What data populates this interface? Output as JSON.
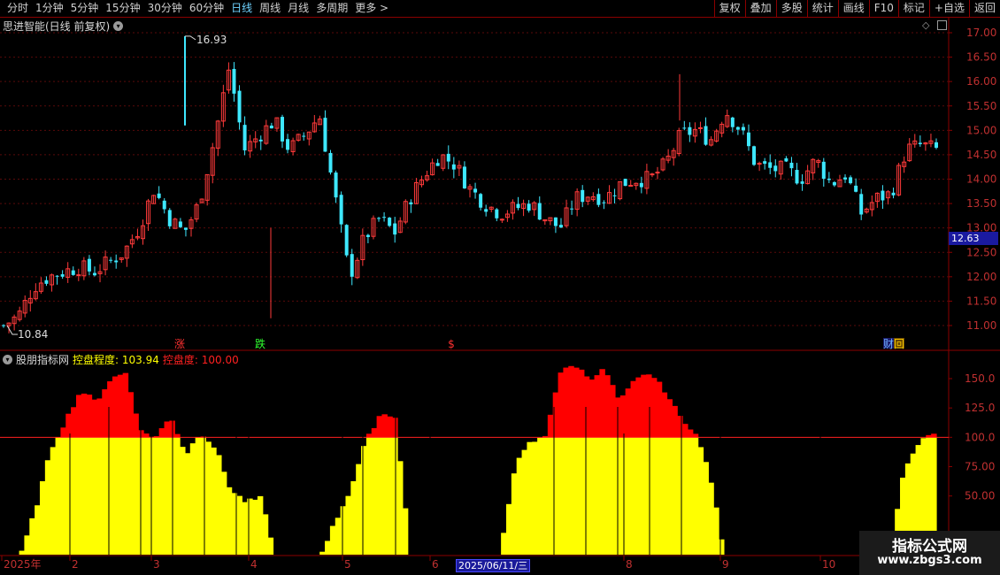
{
  "toolbar": {
    "left": [
      "分时",
      "1分钟",
      "5分钟",
      "15分钟",
      "30分钟",
      "60分钟",
      "日线",
      "周线",
      "月线",
      "多周期",
      "更多 >"
    ],
    "active": "日线",
    "right": [
      "复权",
      "叠加",
      "多股",
      "统计",
      "画线",
      "F10",
      "标记",
      "+自选",
      "返回"
    ]
  },
  "main_chart": {
    "title": "思进智能(日线 前复权)",
    "y_ticks": [
      "17.00",
      "16.50",
      "16.00",
      "15.50",
      "15.00",
      "14.50",
      "14.00",
      "13.50",
      "13.00",
      "12.50",
      "12.00",
      "11.50",
      "11.00"
    ],
    "current_price": "12.63",
    "high_label": "16.93",
    "low_label": "10.84",
    "markers": [
      {
        "text": "涨",
        "color": "#ff3030"
      },
      {
        "text": "跌",
        "color": "#30ff30"
      },
      {
        "text": "$",
        "color": "#ff3030"
      },
      {
        "text": "财",
        "color": "#6fb0ff"
      },
      {
        "text": "回",
        "color": "#ffcc00"
      }
    ]
  },
  "indicator": {
    "name": "股朋指标网",
    "label1": "控盘程度: 103.94",
    "label2": "控盘度: 100.00",
    "y_ticks": [
      "150.0",
      "125.0",
      "100.0",
      "75.00",
      "50.00"
    ],
    "threshold": 100
  },
  "x_axis": {
    "labels": [
      "2025年",
      "2",
      "3",
      "4",
      "5",
      "6",
      "8",
      "9",
      "10"
    ],
    "cursor_date": "2025/06/11/三"
  },
  "watermark": {
    "title": "指标公式网",
    "url": "www.zbgs3.com"
  },
  "colors": {
    "up": "#ff3a3a",
    "down": "#3ee8ff",
    "fill_yellow": "#ffff00",
    "fill_red": "#ff0000",
    "axis": "#8b0000"
  },
  "chart_data": {
    "type": "candlestick+area",
    "candles_anchor_closes": [
      11.0,
      11.2,
      11.8,
      12.0,
      12.1,
      12.2,
      12.1,
      12.3,
      12.5,
      13.0,
      13.8,
      13.2,
      12.9,
      13.5,
      14.8,
      16.3,
      14.6,
      14.9,
      15.2,
      14.6,
      14.9,
      15.3,
      13.7,
      12.0,
      12.8,
      13.2,
      12.9,
      13.6,
      14.1,
      14.5,
      14.3,
      13.8,
      13.5,
      13.3,
      13.4,
      13.5,
      13.2,
      13.0,
      13.6,
      13.7,
      13.6,
      13.9,
      14.0,
      14.0,
      14.3,
      14.9,
      15.0,
      14.8,
      15.4,
      15.0,
      14.3,
      14.2,
      14.2,
      14.0,
      14.4,
      13.9,
      14.1,
      13.3,
      13.6,
      13.7,
      14.6,
      14.7,
      14.6
    ],
    "indicator_anchor_values": [
      0,
      0,
      40,
      90,
      115,
      140,
      130,
      150,
      155,
      105,
      100,
      118,
      85,
      105,
      90,
      55,
      45,
      48,
      0,
      0,
      0,
      0,
      28,
      55,
      95,
      120,
      118,
      0,
      0,
      0,
      0,
      0,
      0,
      0,
      75,
      95,
      100,
      155,
      162,
      150,
      158,
      130,
      148,
      155,
      140,
      118,
      105,
      70,
      0,
      0,
      0,
      0,
      0,
      0,
      0,
      0,
      0,
      0,
      0,
      0,
      70,
      95,
      104
    ],
    "y_main_range": [
      10.7,
      17.2
    ],
    "y_ind_range": [
      0,
      170
    ]
  }
}
